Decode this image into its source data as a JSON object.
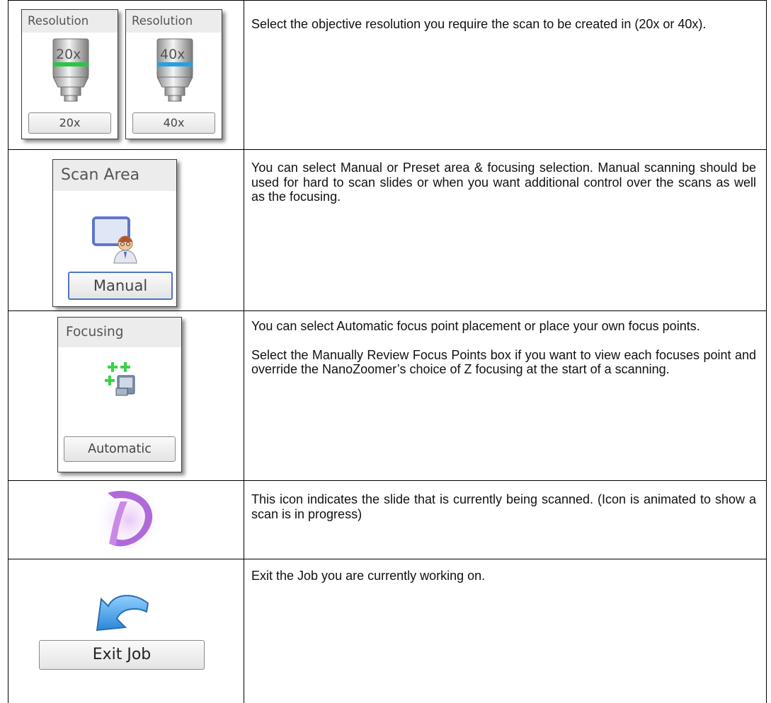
{
  "rows": [
    {
      "panels": [
        {
          "title": "Resolution",
          "lens_label": "20x",
          "button": "20x",
          "band_color": "#2fc24a"
        },
        {
          "title": "Resolution",
          "lens_label": "40x",
          "button": "40x",
          "band_color": "#2a9fe0"
        }
      ],
      "paragraphs": [
        "Select the objective resolution you require the scan to be created in (20x or 40x)."
      ]
    },
    {
      "panel": {
        "title": "Scan Area",
        "button": "Manual",
        "icon": "manual-scan-area-icon"
      },
      "paragraphs": [
        "You can select Manual or Preset area & focusing selection.    Manual scanning should be used for hard to scan slides or when you want additional control over the scans as well as the focusing."
      ]
    },
    {
      "panel": {
        "title": "Focusing",
        "button": "Automatic",
        "icon": "auto-focus-points-icon"
      },
      "paragraphs": [
        "You can select Automatic focus point placement or place your own focus points.",
        "Select the Manually Review Focus Points box if you want to view each focuses point and override the NanoZoomer’s choice of Z focusing at the start of a scanning."
      ]
    },
    {
      "icon": "scanning-slide-icon",
      "paragraphs": [
        "This icon indicates the slide that is currently being scanned. (Icon is animated to show a scan is in progress)"
      ]
    },
    {
      "icon": "exit-arrow-icon",
      "button": "Exit Job",
      "paragraphs": [
        "Exit the Job you are currently working on."
      ]
    }
  ]
}
